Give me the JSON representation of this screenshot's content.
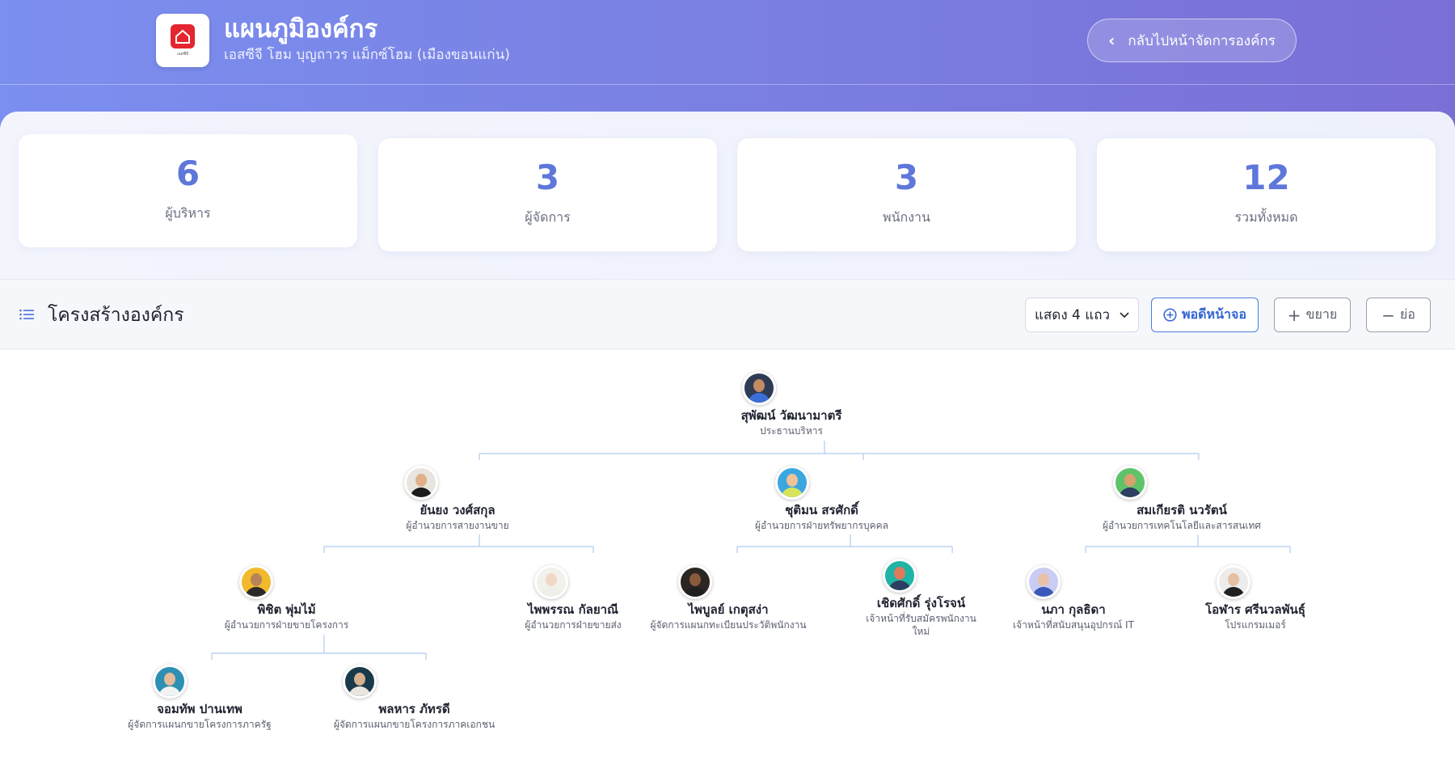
{
  "header": {
    "logo_caption": "เอสซีจี",
    "title": "แผนภูมิองค์กร",
    "subtitle": "เอสซีจี โฮม บุญถาวร แม็กซ์โฮม (เมืองขอนแก่น)",
    "back_label": "กลับไปหน้าจัดการองค์กร",
    "back_icon": "chevron-left-icon"
  },
  "stats": [
    {
      "value": "6",
      "label": "ผู้บริหาร"
    },
    {
      "value": "3",
      "label": "ผู้จัดการ"
    },
    {
      "value": "3",
      "label": "พนักงาน"
    },
    {
      "value": "12",
      "label": "รวมทั้งหมด"
    }
  ],
  "toolbar": {
    "title": "โครงสร้างองค์กร",
    "title_icon": "list-icon",
    "rows_select": "แสดง 4 แถว",
    "fit_label": "พอดีหน้าจอ",
    "expand_label": "ขยาย",
    "collapse_label": "ย่อ"
  },
  "org": [
    {
      "name": "สุพัฒน์ วัฒนามาตรี",
      "role": "ประธานบริหาร",
      "skin": "#c48a62",
      "shirt": "#3b6fd8",
      "bg": "#2d3b55"
    },
    {
      "name": "ยันยง วงศ์สกุล",
      "role": "ผู้อำนวยการสายงานขาย",
      "skin": "#e0b08a",
      "shirt": "#1d1d1d",
      "bg": "#e8e4de"
    },
    {
      "name": "ชุติมน สรศักดิ์",
      "role": "ผู้อำนวยการฝ่ายทรัพยากรบุคคล",
      "skin": "#f0c29a",
      "shirt": "#d7e45a",
      "bg": "#3aa7e0"
    },
    {
      "name": "สมเกียรติ นวรัตน์",
      "role": "ผู้อำนวยการเทคโนโลยีและสารสนเทศ",
      "skin": "#d9a070",
      "shirt": "#2c3e62",
      "bg": "#5fc36a"
    },
    {
      "name": "พิชิต พุ่มไม้",
      "role": "ผู้อำนวยการฝ่ายขายโครงการ",
      "skin": "#b7835b",
      "shirt": "#2a2a2a",
      "bg": "#f1b92b"
    },
    {
      "name": "ไพพรรณ กัลยาณี",
      "role": "ผู้อำนวยการฝ่ายขายส่ง",
      "skin": "#f1d7c5",
      "shirt": "#eeeeea",
      "bg": "#f3f1ec"
    },
    {
      "name": "ไพบูลย์ เกตุสง่า",
      "role": "ผู้จัดการแผนกทะเบียนประวัติพนักงาน",
      "skin": "#8a5a3c",
      "shirt": "#1f1f1f",
      "bg": "#2b2623"
    },
    {
      "name": "เชิดศักดิ์ รุ่งโรจน์",
      "role": "เจ้าหน้าที่รับสมัครพนักงานใหม่",
      "skin": "#e07a5c",
      "shirt": "#2c3e62",
      "bg": "#1fb4a5"
    },
    {
      "name": "นภา กุลธิดา",
      "role": "เจ้าหน้าที่สนับสนุนอุปกรณ์ IT",
      "skin": "#e8c2a6",
      "shirt": "#3b5ab7",
      "bg": "#c9cdf4"
    },
    {
      "name": "โอฬาร ศรีนวลพันธุ์",
      "role": "โปรแกรมเมอร์",
      "skin": "#e5c0a2",
      "shirt": "#202020",
      "bg": "#ececec"
    },
    {
      "name": "จอมทัพ ปานเทพ",
      "role": "ผู้จัดการแผนกขายโครงการภาครัฐ",
      "skin": "#e4bc9c",
      "shirt": "#f2f2f2",
      "bg": "#2c8fb3"
    },
    {
      "name": "พลหาร ภัทรดี",
      "role": "ผู้จัดการแผนกขายโครงการภาคเอกชน",
      "skin": "#d7b08f",
      "shirt": "#e9e6df",
      "bg": "#183a4a"
    }
  ]
}
